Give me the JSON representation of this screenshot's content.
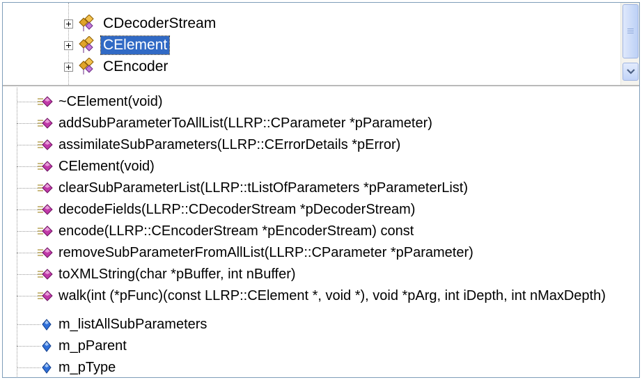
{
  "class_tree": {
    "items": [
      {
        "label": "CDecoderStream",
        "selected": false
      },
      {
        "label": "CElement",
        "selected": true
      },
      {
        "label": "CEncoder",
        "selected": false
      }
    ]
  },
  "members": {
    "methods": [
      "~CElement(void)",
      "addSubParameterToAllList(LLRP::CParameter *pParameter)",
      "assimilateSubParameters(LLRP::CErrorDetails *pError)",
      "CElement(void)",
      "clearSubParameterList(LLRP::tListOfParameters *pParameterList)",
      "decodeFields(LLRP::CDecoderStream *pDecoderStream)",
      "encode(LLRP::CEncoderStream *pEncoderStream) const",
      "removeSubParameterFromAllList(LLRP::CParameter *pParameter)",
      "toXMLString(char *pBuffer, int nBuffer)",
      "walk(int (*pFunc)(const LLRP::CElement *, void *), void *pArg, int iDepth, int nMaxDepth)"
    ],
    "fields": [
      "m_listAllSubParameters",
      "m_pParent",
      "m_pType"
    ]
  },
  "icons": {
    "class": "class-icon",
    "method": "method-icon",
    "field": "field-icon",
    "expander": "plus-expander-icon",
    "scroll_down": "chevron-down-icon"
  },
  "colors": {
    "selection": "#316ac5",
    "method_icon": "#c03aa8",
    "field_icon": "#2f6fd8"
  }
}
